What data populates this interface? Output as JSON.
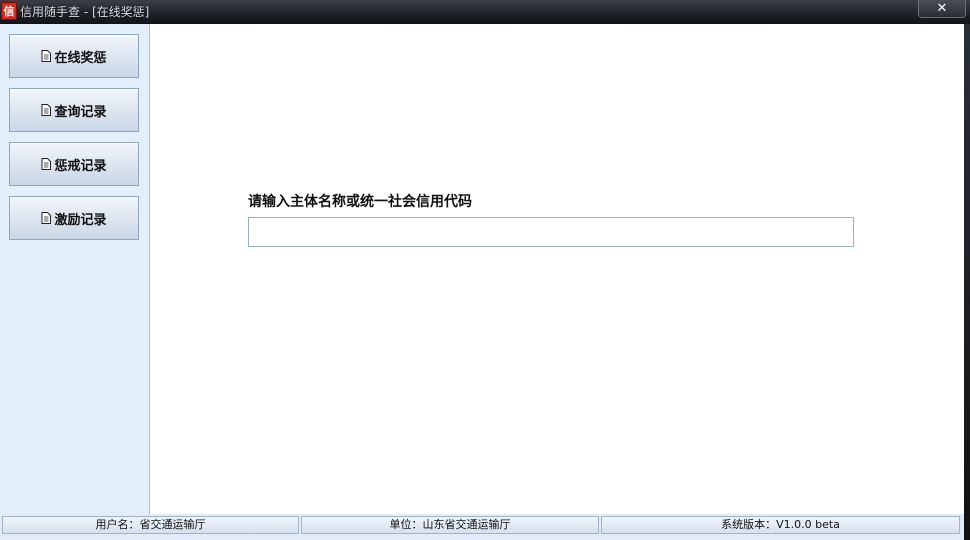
{
  "window": {
    "title": "信用随手查 - [在线奖惩]",
    "app_icon_glyph": "信",
    "close_glyph": "✕"
  },
  "sidebar": {
    "items": [
      {
        "label": "在线奖惩",
        "icon": "document-icon"
      },
      {
        "label": "查询记录",
        "icon": "document-icon"
      },
      {
        "label": "惩戒记录",
        "icon": "document-icon"
      },
      {
        "label": "激励记录",
        "icon": "document-icon"
      }
    ]
  },
  "main": {
    "prompt": "请输入主体名称或统一社会信用代码",
    "search_value": "",
    "search_placeholder": ""
  },
  "status": {
    "user": "用户名：省交通运输厅",
    "unit": "单位：山东省交通运输厅",
    "version": "系统版本：V1.0.0 beta"
  },
  "colors": {
    "accent_red": "#d42a20",
    "sidebar_bg": "#e3eefb",
    "border_blue": "#8ea6c2"
  }
}
